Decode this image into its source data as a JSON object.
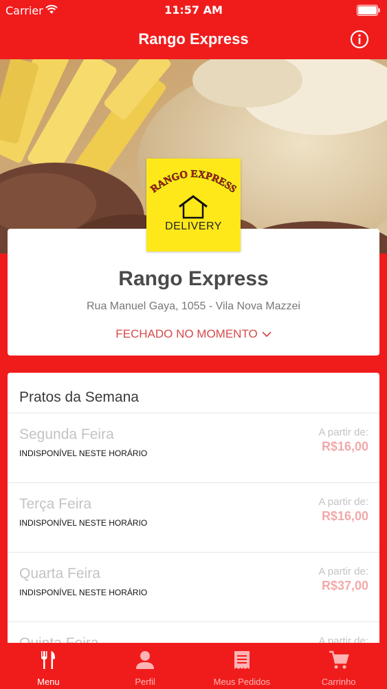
{
  "status_bar": {
    "carrier": "Carrier",
    "time": "11:57 AM"
  },
  "nav": {
    "title": "Rango Express",
    "info_icon": "info-icon"
  },
  "logo": {
    "arc_text": "RANGO EXPRESS",
    "sub_text": "DELIVERY",
    "background": "#ffe81a"
  },
  "restaurant": {
    "name": "Rango Express",
    "address": "Rua Manuel Gaya, 1055 - Vila Nova Mazzei",
    "status": "FECHADO NO MOMENTO"
  },
  "menu": {
    "title": "Pratos da Semana",
    "items": [
      {
        "name": "Segunda Feira",
        "status": "INDISPONÍVEL NESTE HORÁRIO",
        "from": "A partir de:",
        "price": "R$16,00"
      },
      {
        "name": "Terça Feira",
        "status": "INDISPONÍVEL NESTE HORÁRIO",
        "from": "A partir de:",
        "price": "R$16,00"
      },
      {
        "name": "Quarta Feira",
        "status": "INDISPONÍVEL NESTE HORÁRIO",
        "from": "A partir de:",
        "price": "R$37,00"
      },
      {
        "name": "Quinta Feira",
        "status": "",
        "from": "A partir de:",
        "price": ""
      }
    ]
  },
  "tabs": [
    {
      "label": "Menu",
      "icon": "fork-knife-icon",
      "active": true
    },
    {
      "label": "Perfil",
      "icon": "person-icon",
      "active": false
    },
    {
      "label": "Meus Pedidos",
      "icon": "receipt-icon",
      "active": false
    },
    {
      "label": "Carrinho",
      "icon": "cart-icon",
      "active": false
    }
  ],
  "colors": {
    "brand_red": "#f01c1c",
    "status_red": "#d64a4a",
    "price_pink": "#f2a9a9"
  }
}
